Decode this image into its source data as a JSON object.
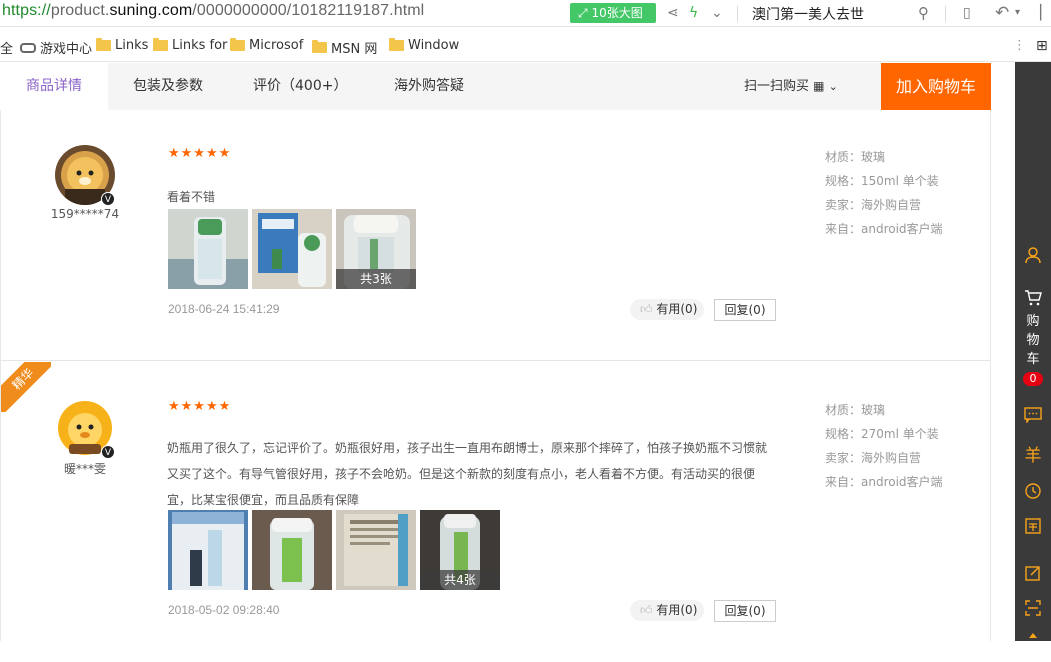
{
  "browser": {
    "url_scheme": "https://",
    "url_host_prefix": "product.",
    "url_host": "suning.com",
    "url_path": "/0000000000/10182119187.html",
    "big_image_button": "10张大图",
    "news_headline": "澳门第一美人去世"
  },
  "bookmarks": {
    "edge_label": "全",
    "items": [
      {
        "label": "游戏中心",
        "icon": "gamepad-icon"
      },
      {
        "label": "Links",
        "icon": "folder-icon"
      },
      {
        "label": "Links for",
        "icon": "folder-icon"
      },
      {
        "label": "Microsof",
        "icon": "folder-icon"
      },
      {
        "label": "MSN 网",
        "icon": "folder-icon"
      },
      {
        "label": "Window",
        "icon": "folder-icon"
      }
    ]
  },
  "tabs": [
    {
      "label": "商品详情",
      "active": true
    },
    {
      "label": "包装及参数",
      "active": false
    },
    {
      "label": "评价（400+）",
      "active": false
    },
    {
      "label": "海外购答疑",
      "active": false
    }
  ],
  "scan_buy": "扫一扫购买",
  "add_to_cart": "加入购物车",
  "sidebar": {
    "cart_label_chars": [
      "购",
      "物",
      "车"
    ],
    "cart_count": "0",
    "icons": [
      "user-icon",
      "cart-icon",
      "chat-icon",
      "yen-icon",
      "history-icon",
      "coupon-icon",
      "edit-icon",
      "scan-icon"
    ]
  },
  "reviews": [
    {
      "username": "159*****74",
      "stars": "★★★★★",
      "text": "看着不错",
      "photo_count_label": "共3张",
      "date": "2018-06-24 15:41:29",
      "useful_label": "有用(0)",
      "reply_label": "回复(0)",
      "meta": [
        "材质：玻璃",
        "规格：150ml 单个装",
        "卖家：海外购自营",
        "来自：android客户端"
      ],
      "featured": false
    },
    {
      "username": "暖***雯",
      "stars": "★★★★★",
      "text": "奶瓶用了很久了，忘记评价了。奶瓶很好用，孩子出生一直用布朗博士，原来那个摔碎了，怕孩子换奶瓶不习惯就又买了这个。有导气管很好用，孩子不会呛奶。但是这个新款的刻度有点小，老人看着不方便。有活动买的很便宜，比某宝很便宜，而且品质有保障",
      "photo_count_label": "共4张",
      "date": "2018-05-02 09:28:40",
      "useful_label": "有用(0)",
      "reply_label": "回复(0)",
      "meta": [
        "材质：玻璃",
        "规格：270ml 单个装",
        "卖家：海外购自营",
        "来自：android客户端"
      ],
      "featured": true,
      "featured_label": "精华"
    }
  ],
  "colors": {
    "accent_orange": "#ff6600",
    "tab_active": "#8a63c7",
    "sidebar_bg": "#3a3a3a",
    "sidebar_icon": "#f7a31a",
    "badge_red": "#e60012",
    "green_button": "#44c767"
  }
}
